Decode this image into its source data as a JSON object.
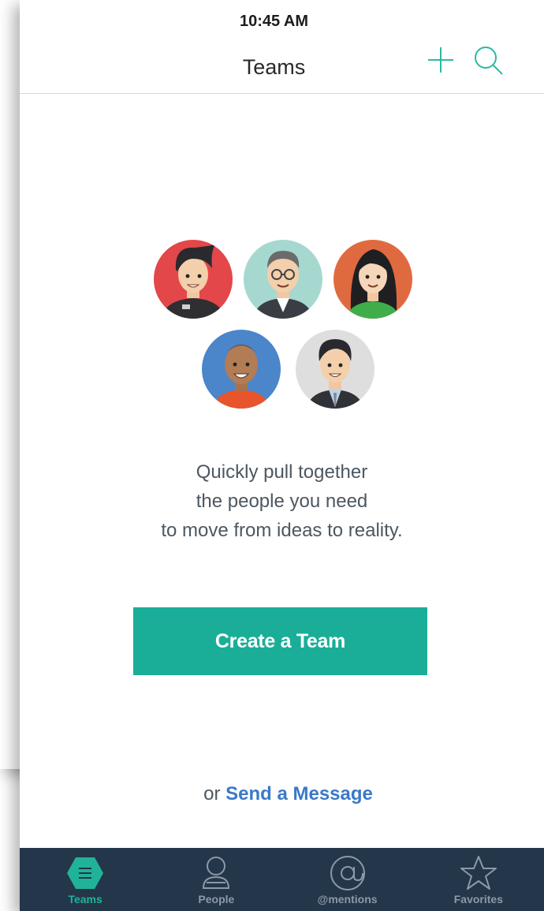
{
  "background_screen": {
    "search_icon": "search-icon"
  },
  "status_bar": {
    "time": "10:45 AM"
  },
  "nav": {
    "title": "Teams",
    "add_icon": "plus-icon",
    "search_icon": "search-icon"
  },
  "empty_state": {
    "illustration": "team-avatars-illustration",
    "tagline": [
      "Quickly pull together",
      "the people you need",
      "to move from ideas to reality."
    ],
    "create_button": "Create a Team",
    "send_prefix": "or",
    "send_link": "Send a Message"
  },
  "tabs": [
    {
      "label": "Teams",
      "icon": "teams-icon",
      "active": true
    },
    {
      "label": "People",
      "icon": "person-icon",
      "active": false
    },
    {
      "label": "@mentions",
      "icon": "at-icon",
      "active": false
    },
    {
      "label": "Favorites",
      "icon": "star-icon",
      "active": false
    }
  ],
  "colors": {
    "accent": "#1aae98",
    "link": "#3b79c8",
    "tabbar": "#24364a",
    "tab_inactive": "#8d99a7"
  }
}
